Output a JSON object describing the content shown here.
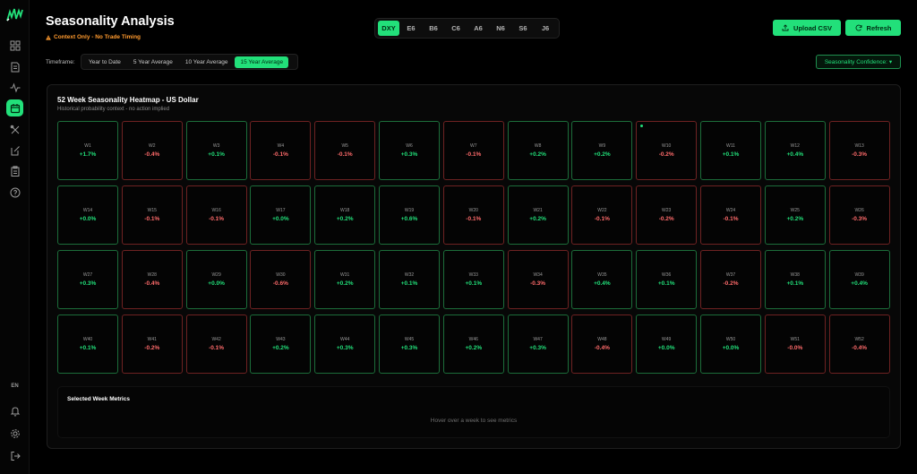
{
  "header": {
    "title": "Seasonality Analysis",
    "context_note": "Context Only - No Trade Timing",
    "upload_label": "Upload CSV",
    "refresh_label": "Refresh"
  },
  "symbols": [
    "DXY",
    "E6",
    "B6",
    "C6",
    "A6",
    "N6",
    "S6",
    "J6"
  ],
  "active_symbol": "DXY",
  "timeframe": {
    "label": "Timeframe:",
    "options": [
      "Year to Date",
      "5 Year Average",
      "10 Year Average",
      "15 Year Average"
    ],
    "active": "15 Year Average"
  },
  "confidence_label": "Seasonality Confidence:",
  "sidebar": {
    "language": "EN",
    "items": [
      "dashboard-icon",
      "document-icon",
      "activity-icon",
      "calendar-icon",
      "tools-icon",
      "journal-icon",
      "clipboard-icon",
      "help-icon"
    ],
    "bottom_items": [
      "bell-icon",
      "settings-icon",
      "logout-icon"
    ],
    "active": "calendar-icon"
  },
  "heatmap": {
    "title": "52 Week Seasonality Heatmap - US Dollar",
    "subtitle": "Historical probability context - no action implied",
    "weeks": [
      {
        "label": "W1",
        "value": "+1.7%"
      },
      {
        "label": "W2",
        "value": "-0.4%"
      },
      {
        "label": "W3",
        "value": "+0.1%"
      },
      {
        "label": "W4",
        "value": "-0.1%"
      },
      {
        "label": "W5",
        "value": "-0.1%"
      },
      {
        "label": "W6",
        "value": "+0.3%"
      },
      {
        "label": "W7",
        "value": "-0.1%"
      },
      {
        "label": "W8",
        "value": "+0.2%"
      },
      {
        "label": "W9",
        "value": "+0.2%"
      },
      {
        "label": "W10",
        "value": "-0.2%",
        "marker": true
      },
      {
        "label": "W11",
        "value": "+0.1%"
      },
      {
        "label": "W12",
        "value": "+0.4%"
      },
      {
        "label": "W13",
        "value": "-0.3%"
      },
      {
        "label": "W14",
        "value": "+0.0%"
      },
      {
        "label": "W15",
        "value": "-0.1%"
      },
      {
        "label": "W16",
        "value": "-0.1%"
      },
      {
        "label": "W17",
        "value": "+0.0%"
      },
      {
        "label": "W18",
        "value": "+0.2%"
      },
      {
        "label": "W19",
        "value": "+0.6%"
      },
      {
        "label": "W20",
        "value": "-0.1%"
      },
      {
        "label": "W21",
        "value": "+0.2%"
      },
      {
        "label": "W22",
        "value": "-0.1%"
      },
      {
        "label": "W23",
        "value": "-0.2%"
      },
      {
        "label": "W24",
        "value": "-0.1%"
      },
      {
        "label": "W25",
        "value": "+0.2%"
      },
      {
        "label": "W26",
        "value": "-0.3%"
      },
      {
        "label": "W27",
        "value": "+0.3%"
      },
      {
        "label": "W28",
        "value": "-0.4%"
      },
      {
        "label": "W29",
        "value": "+0.0%"
      },
      {
        "label": "W30",
        "value": "-0.6%"
      },
      {
        "label": "W31",
        "value": "+0.2%"
      },
      {
        "label": "W32",
        "value": "+0.1%"
      },
      {
        "label": "W33",
        "value": "+0.1%"
      },
      {
        "label": "W34",
        "value": "-0.3%"
      },
      {
        "label": "W35",
        "value": "+0.4%"
      },
      {
        "label": "W36",
        "value": "+0.1%"
      },
      {
        "label": "W37",
        "value": "-0.2%"
      },
      {
        "label": "W38",
        "value": "+0.1%"
      },
      {
        "label": "W39",
        "value": "+0.4%"
      },
      {
        "label": "W40",
        "value": "+0.1%"
      },
      {
        "label": "W41",
        "value": "-0.2%"
      },
      {
        "label": "W42",
        "value": "-0.1%"
      },
      {
        "label": "W43",
        "value": "+0.2%"
      },
      {
        "label": "W44",
        "value": "+0.3%"
      },
      {
        "label": "W45",
        "value": "+0.3%"
      },
      {
        "label": "W46",
        "value": "+0.2%"
      },
      {
        "label": "W47",
        "value": "+0.3%"
      },
      {
        "label": "W48",
        "value": "-0.4%"
      },
      {
        "label": "W49",
        "value": "+0.0%"
      },
      {
        "label": "W50",
        "value": "+0.0%"
      },
      {
        "label": "W51",
        "value": "-0.0%"
      },
      {
        "label": "W52",
        "value": "-0.4%"
      }
    ]
  },
  "metrics": {
    "title": "Selected Week Metrics",
    "hint": "Hover over a week to see metrics"
  },
  "colors": {
    "accent": "#22e07a",
    "positive_border": "#1c6d3a",
    "negative_border": "#6e2222",
    "negative_text": "#ff6b6b",
    "warning": "#ff9a2e"
  }
}
